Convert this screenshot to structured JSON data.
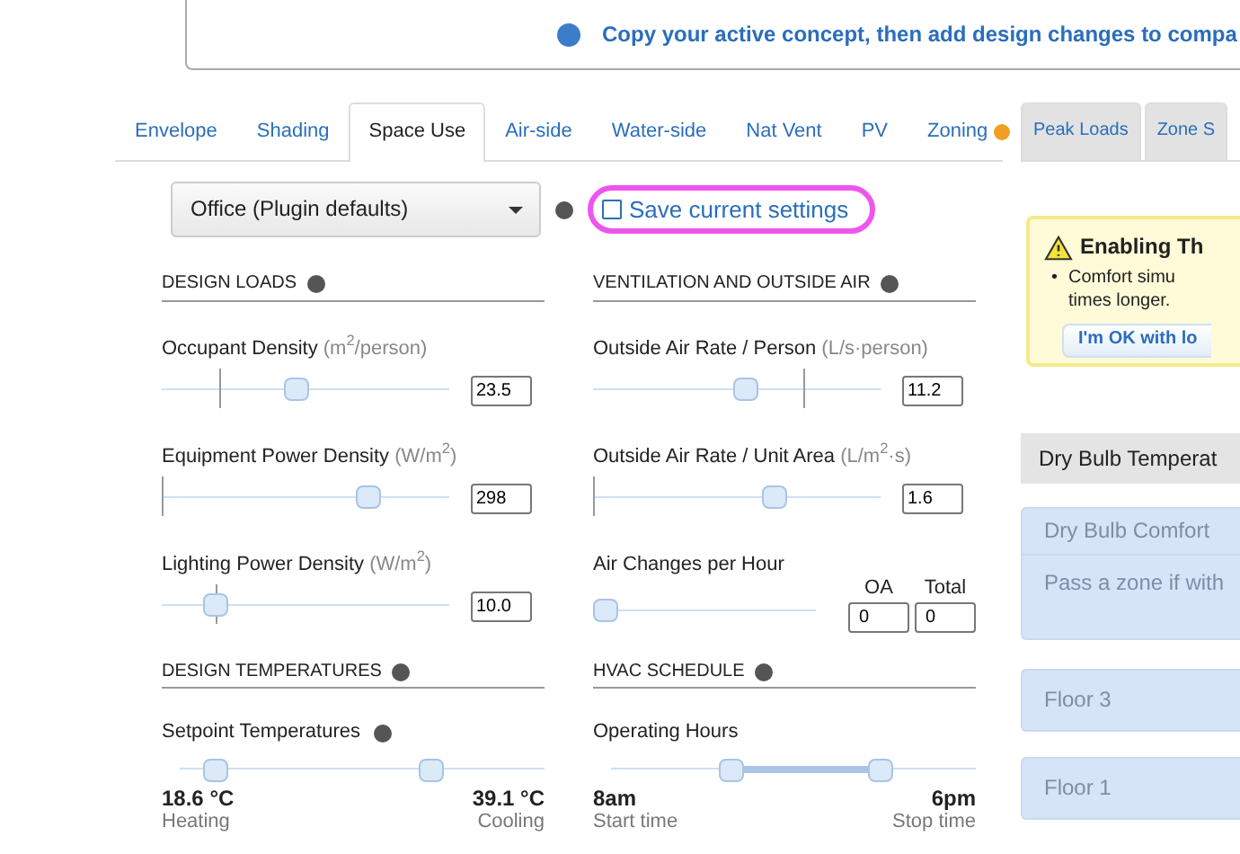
{
  "banner": {
    "text": "Copy your active concept, then add design changes to compa"
  },
  "tabs": [
    {
      "label": "Envelope",
      "selected": false,
      "alert": false
    },
    {
      "label": "Shading",
      "selected": false,
      "alert": false
    },
    {
      "label": "Space Use",
      "selected": true,
      "alert": false
    },
    {
      "label": "Air-side",
      "selected": false,
      "alert": false
    },
    {
      "label": "Water-side",
      "selected": false,
      "alert": false
    },
    {
      "label": "Nat Vent",
      "selected": false,
      "alert": false
    },
    {
      "label": "PV",
      "selected": false,
      "alert": false
    },
    {
      "label": "Zoning",
      "selected": false,
      "alert": true
    }
  ],
  "preset": {
    "value": "Office (Plugin defaults)",
    "save_link": "Save current settings"
  },
  "columns": [
    [
      {
        "title": "DESIGN LOADS",
        "items": [
          {
            "kind": "slider",
            "label": "Occupant Density",
            "unit": "(m$^{2}$/person)",
            "value": "23.5",
            "level": 0.47,
            "marker": {
              "level": 0.2
            }
          },
          {
            "kind": "slider",
            "label": "Equipment Power Density",
            "unit": "(W/m$^{2}$)",
            "value": "298",
            "level": 0.72,
            "marker": {
              "level": 0.0
            }
          },
          {
            "kind": "slider",
            "label": "Lighting Power Density",
            "unit": "(W/m$^{2}$)",
            "value": "10.0",
            "level": 0.19,
            "marker": {
              "level": 0.19
            }
          }
        ]
      },
      {
        "title": "DESIGN TEMPERATURES",
        "items": [
          {
            "kind": "range",
            "label": "Setpoint Temperatures",
            "help": true,
            "filled": false,
            "low": {
              "level": 0.1,
              "value": "18.6 °C",
              "caption": "Heating"
            },
            "high": {
              "level": 0.69,
              "value": "39.1 °C",
              "caption": "Cooling"
            }
          }
        ]
      }
    ],
    [
      {
        "title": "VENTILATION AND OUTSIDE AIR",
        "items": [
          {
            "kind": "slider",
            "label": "Outside Air Rate / Person",
            "unit": "(L/s·person)",
            "value": "11.2",
            "level": 0.53,
            "marker": {
              "level": 0.73
            }
          },
          {
            "kind": "slider",
            "label": "Outside Air Rate / Unit Area",
            "unit": "(L/m$^{2}$·s)",
            "value": "1.6",
            "level": 0.63,
            "marker": {
              "level": 0.0
            }
          },
          {
            "kind": "ach",
            "label": "Air Changes per Hour",
            "level": 0.0,
            "fields": [
              {
                "label": "OA",
                "value": "0"
              },
              {
                "label": "Total",
                "value": "0"
              }
            ]
          }
        ]
      },
      {
        "title": "HVAC SCHEDULE",
        "items": [
          {
            "kind": "range",
            "label": "Operating Hours",
            "help": false,
            "filled": true,
            "low": {
              "level": 0.33,
              "value": "8am",
              "caption": "Start time"
            },
            "high": {
              "level": 0.74,
              "value": "6pm",
              "caption": "Stop time"
            }
          }
        ]
      }
    ]
  ],
  "right_tabs": [
    {
      "label": "Peak Loads"
    },
    {
      "label": "Zone S"
    }
  ],
  "notice": {
    "title": "Enabling Th",
    "bullet": "•",
    "lines": [
      "Comfort simu",
      "times longer."
    ],
    "button": "I'm OK with lo"
  },
  "metric": {
    "label": "Dry Bulb Temperat"
  },
  "criteria": {
    "title": "Dry Bulb Comfort",
    "body": "Pass a zone if with"
  },
  "zones": [
    {
      "label": "Floor 3"
    },
    {
      "label": "Floor 1"
    }
  ]
}
